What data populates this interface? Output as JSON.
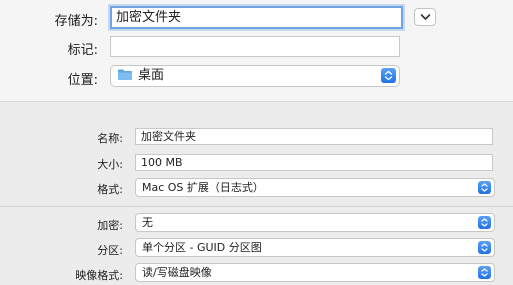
{
  "save": {
    "save_as_label": "存储为:",
    "save_as_value": "加密文件夹",
    "tags_label": "标记:",
    "tags_value": "",
    "where_label": "位置:",
    "where_value": "桌面"
  },
  "options": {
    "name_label": "名称:",
    "name_value": "加密文件夹",
    "size_label": "大小:",
    "size_value": "100 MB",
    "format_label": "格式:",
    "format_value": "Mac OS 扩展（日志式）",
    "encryption_label": "加密:",
    "encryption_value": "无",
    "partitions_label": "分区:",
    "partitions_value": "单个分区 - GUID 分区图",
    "image_format_label": "映像格式:",
    "image_format_value": "读/写磁盘映像"
  },
  "colors": {
    "accent": "#1f72e8",
    "focus_ring": "#6fa3e3",
    "folder": "#5aa9e6"
  },
  "icons": {
    "expand": "chevron-down-icon",
    "stepper": "up-down-chevron-icon",
    "folder": "folder-icon"
  }
}
